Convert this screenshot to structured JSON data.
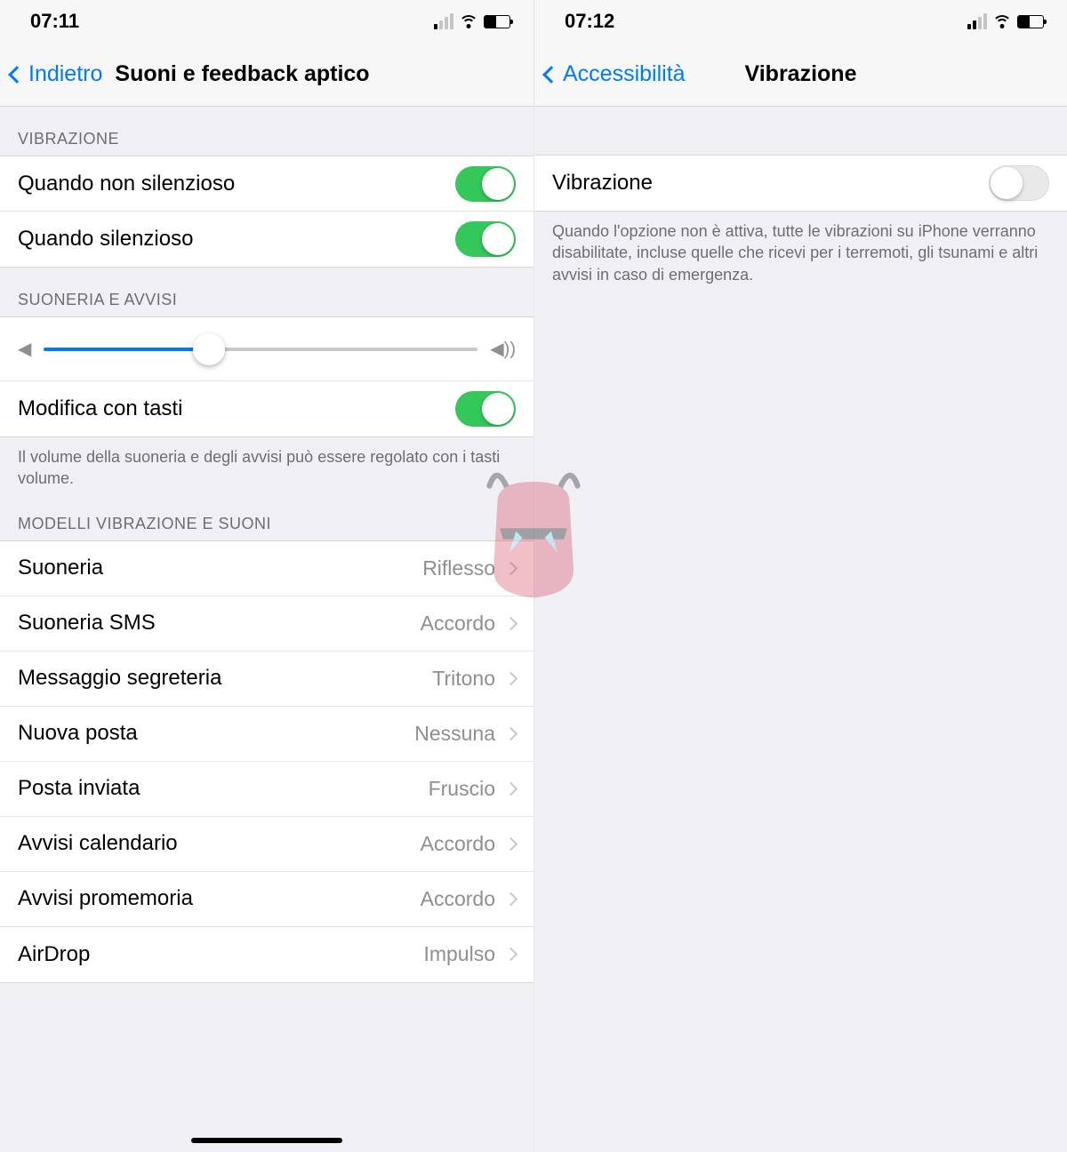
{
  "left": {
    "statusTime": "07:11",
    "back": "Indietro",
    "title": "Suoni e feedback aptico",
    "sections": {
      "vibrazione": {
        "header": "VIBRAZIONE",
        "rows": [
          {
            "label": "Quando non silenzioso",
            "on": true
          },
          {
            "label": "Quando silenzioso",
            "on": true
          }
        ]
      },
      "suoneria": {
        "header": "SUONERIA E AVVISI",
        "sliderPercent": 38,
        "modificaLabel": "Modifica con tasti",
        "modificaOn": true,
        "footer": "Il volume della suoneria e degli avvisi può essere regolato con i tasti volume."
      },
      "modelli": {
        "header": "MODELLI VIBRAZIONE E SUONI",
        "rows": [
          {
            "label": "Suoneria",
            "value": "Riflesso"
          },
          {
            "label": "Suoneria SMS",
            "value": "Accordo"
          },
          {
            "label": "Messaggio segreteria",
            "value": "Tritono"
          },
          {
            "label": "Nuova posta",
            "value": "Nessuna"
          },
          {
            "label": "Posta inviata",
            "value": "Fruscio"
          },
          {
            "label": "Avvisi calendario",
            "value": "Accordo"
          },
          {
            "label": "Avvisi promemoria",
            "value": "Accordo"
          },
          {
            "label": "AirDrop",
            "value": "Impulso"
          }
        ]
      }
    }
  },
  "right": {
    "statusTime": "07:12",
    "back": "Accessibilità",
    "title": "Vibrazione",
    "toggle": {
      "label": "Vibrazione",
      "on": false
    },
    "footer": "Quando l'opzione non è attiva, tutte le vibrazioni su iPhone verranno disabilitate, incluse quelle che ricevi per i terremoti, gli tsunami e altri avvisi in caso di emergenza."
  }
}
